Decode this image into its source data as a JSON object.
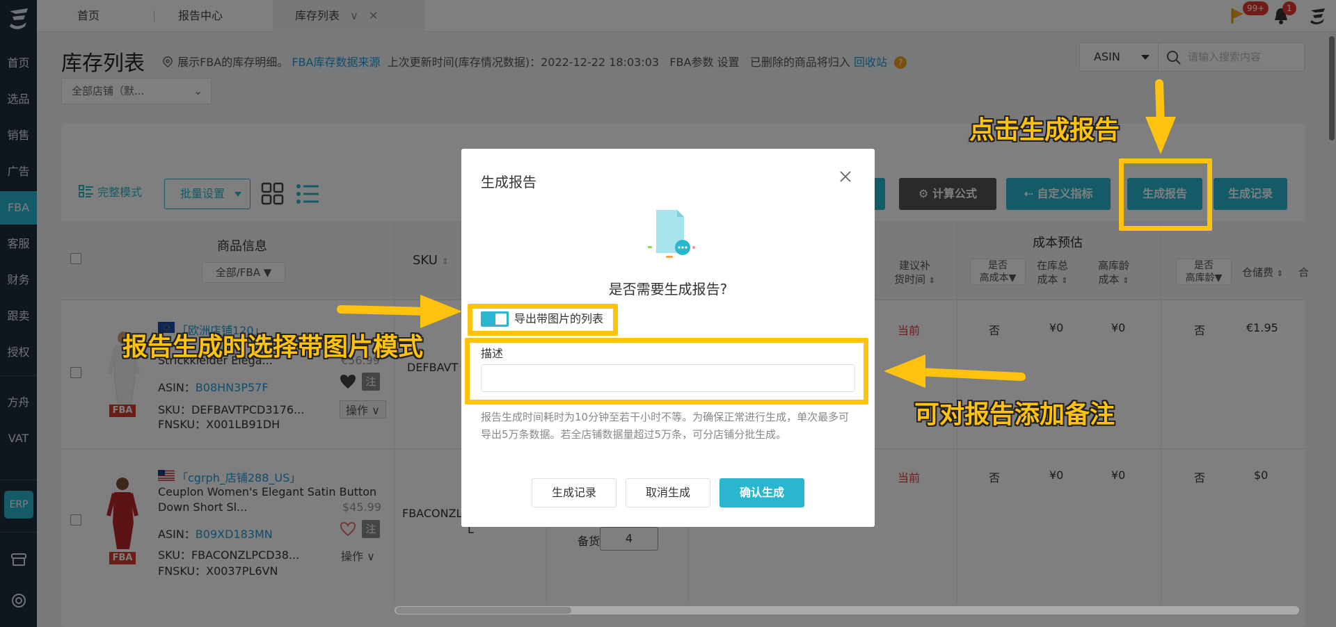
{
  "sidebar": {
    "items": [
      {
        "label": "首页"
      },
      {
        "label": "选品"
      },
      {
        "label": "销售"
      },
      {
        "label": "广告"
      },
      {
        "label": "FBA"
      },
      {
        "label": "客服"
      },
      {
        "label": "财务"
      },
      {
        "label": "跟卖"
      },
      {
        "label": "授权"
      },
      {
        "label": "方舟"
      },
      {
        "label": "VAT"
      }
    ],
    "erp_label": "ERP"
  },
  "tabs": [
    {
      "label": "首页"
    },
    {
      "label": "报告中心"
    },
    {
      "label": "库存列表"
    }
  ],
  "notifications": {
    "flag_badge": "99+",
    "bell_badge": "1"
  },
  "header": {
    "title": "库存列表",
    "info_prefix": "展示FBA的库存明细。",
    "data_source_link": "FBA库存数据来源",
    "update_time": "上次更新时间(库存情况数据)：2022-12-22 18:03:03",
    "fba_param": "FBA参数",
    "settings_link": "设置",
    "deleted_note": "已删除的商品将归入",
    "recycle_link": "回收站",
    "help": "?",
    "store_select": "全部店铺（默...",
    "search_type": "ASIN",
    "search_placeholder": "请输入搜索内容"
  },
  "toolbar": {
    "view_mode": "完整模式",
    "batch_settings": "批量设置",
    "formula": "计算公式",
    "custom_metrics": "自定义指标",
    "generate_report": "生成报告",
    "generate_records": "生成记录"
  },
  "table": {
    "product_info": "商品信息",
    "product_filter": "全部/FBA",
    "sku": "SKU",
    "suggest_restock_1": "建议补",
    "suggest_restock_2": "货时间",
    "cost_estimate": "成本预估",
    "high_cost_1": "是否",
    "high_cost_2": "高成本",
    "stock_cost_1": "在库总",
    "stock_cost_2": "成本",
    "aged_cost_1": "高库龄",
    "aged_cost_2": "成本",
    "high_age_1": "是否",
    "high_age_2": "高库龄",
    "storage_fee": "仓储费",
    "cut_col": "合",
    "rows": [
      {
        "store": "「欧洲店铺120」",
        "title": "Strickkleider Elega...",
        "price": "€56.99",
        "asin_label": "ASIN：",
        "asin": "B08HN3P57F",
        "sku_label": "SKU：",
        "sku": "DEFBAVTPCD3176...",
        "fnsku_label": "FNSKU：",
        "fnsku": "X001LB91DH",
        "note": "注",
        "op": "操作 ∨",
        "fba": "FBA",
        "sku_col": "DEFBAVT",
        "when": "当前",
        "high_cost": "否",
        "stock_cost": "¥0",
        "aged_cost": "¥0",
        "high_age": "否",
        "storage": "€1.95"
      },
      {
        "store": "「cgrph_店铺288_US」",
        "title1": "Ceuplon Women's Elegant Satin Button",
        "title2": "Down Short Sl...",
        "price": "$45.99",
        "asin_label": "ASIN：",
        "asin": "B09XD183MN",
        "sku_label": "SKU：",
        "sku": "FBACONZLPCD38...",
        "fnsku_label": "FNSKU：",
        "fnsku": "X0037PL6VN",
        "note": "注",
        "op": "操作 ∨",
        "fba": "FBA",
        "sku_col": "FBACONZL",
        "sku_col2": "L",
        "when": "当前",
        "high_cost": "否",
        "stock_cost": "¥0",
        "aged_cost": "¥0",
        "high_age": "否",
        "storage": "$0",
        "stock_label": "备货:",
        "stock_value": "4"
      }
    ]
  },
  "modal": {
    "title": "生成报告",
    "question": "是否需要生成报告?",
    "switch_label": "导出带图片的列表",
    "desc_label": "描述",
    "hint": "报告生成时间耗时为10分钟至若干小时不等。为确保正常进行生成，单次最多可导出5万条数据。若全店铺数据量超过5万条，可分店铺分批生成。",
    "btn_records": "生成记录",
    "btn_cancel": "取消生成",
    "btn_confirm": "确认生成"
  },
  "annotations": {
    "click_generate": "点击生成报告",
    "image_mode": "报告生成时选择带图片模式",
    "add_note": "可对报告添加备注"
  },
  "colors": {
    "accent": "#2bb6cf",
    "annotation": "#ffc20e",
    "sidebar": "#1f2d3d"
  }
}
